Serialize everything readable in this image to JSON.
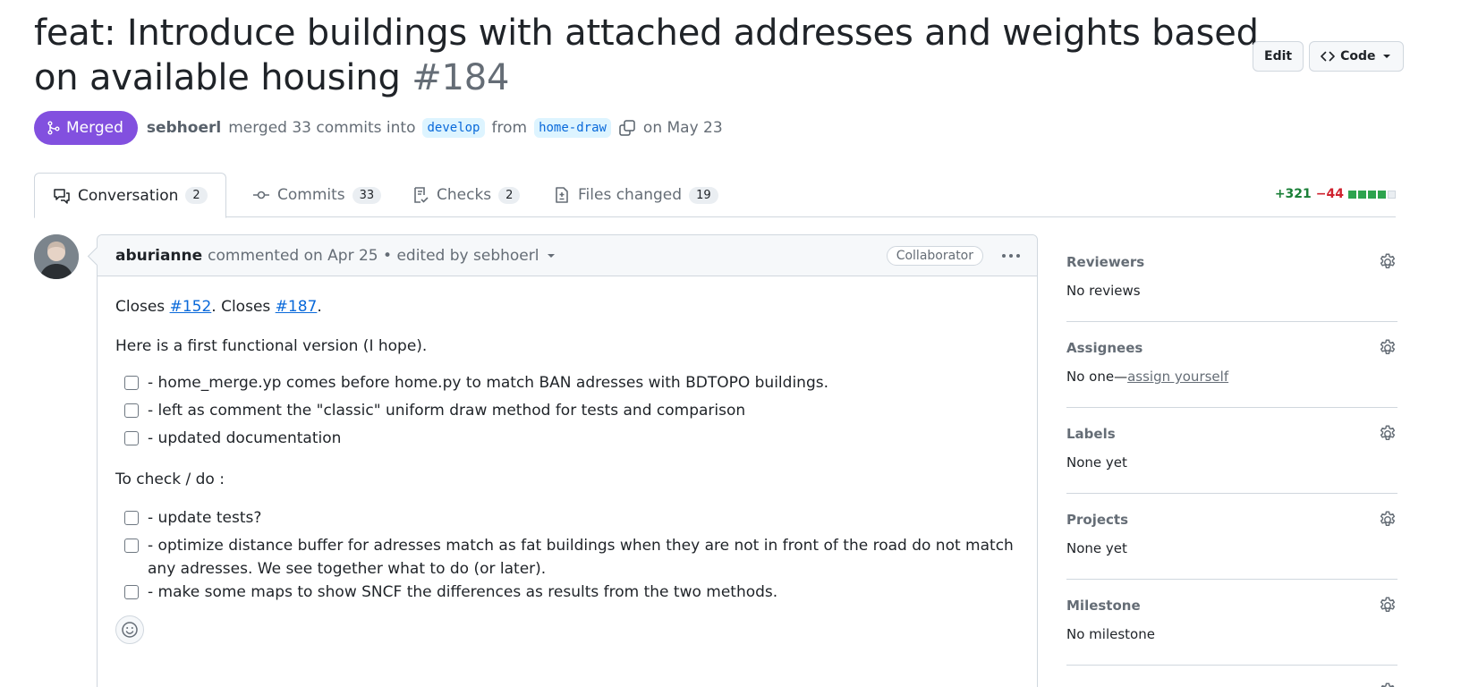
{
  "pr": {
    "title": "feat: Introduce buildings with attached addresses and weights based on available housing",
    "number": "#184",
    "state": "Merged",
    "author": "sebhoerl",
    "merge_text": "merged 33 commits into",
    "base_branch": "develop",
    "from_text": "from",
    "head_branch": "home-draw",
    "date_text": "on May 23"
  },
  "header_actions": {
    "edit": "Edit",
    "code": "Code"
  },
  "tabs": [
    {
      "label": "Conversation",
      "count": "2"
    },
    {
      "label": "Commits",
      "count": "33"
    },
    {
      "label": "Checks",
      "count": "2"
    },
    {
      "label": "Files changed",
      "count": "19"
    }
  ],
  "diffstat": {
    "additions": "+321",
    "deletions": "−44"
  },
  "comment": {
    "author": "aburianne",
    "meta": "commented on Apr 25 • edited by sebhoerl",
    "badge": "Collaborator",
    "closes_prefix": "Closes ",
    "issue1": "#152",
    "closes_mid": ". Closes ",
    "issue2": "#187",
    "closes_end": ".",
    "intro": "Here is a first functional version (I hope).",
    "tasks1": [
      "- home_merge.yp comes before home.py to match BAN adresses with BDTOPO buildings.",
      "- left as comment the \"classic\" uniform draw method for tests and comparison",
      "- updated documentation"
    ],
    "todo_heading": "To check / do :",
    "tasks2": [
      "- update tests?",
      "- optimize distance buffer for adresses match as fat buildings when they are not in front of the road do not match any adresses. We see together what to do (or later).",
      "- make some maps to show SNCF the differences as results from the two methods."
    ]
  },
  "sidebar": [
    {
      "title": "Reviewers",
      "value": "No reviews"
    },
    {
      "title": "Assignees",
      "value": "No one—",
      "link": "assign yourself"
    },
    {
      "title": "Labels",
      "value": "None yet"
    },
    {
      "title": "Projects",
      "value": "None yet"
    },
    {
      "title": "Milestone",
      "value": "No milestone"
    }
  ],
  "colors": {
    "merged": "#8250df",
    "link": "#0969da",
    "additions": "#1a7f37",
    "deletions": "#cf222e"
  }
}
